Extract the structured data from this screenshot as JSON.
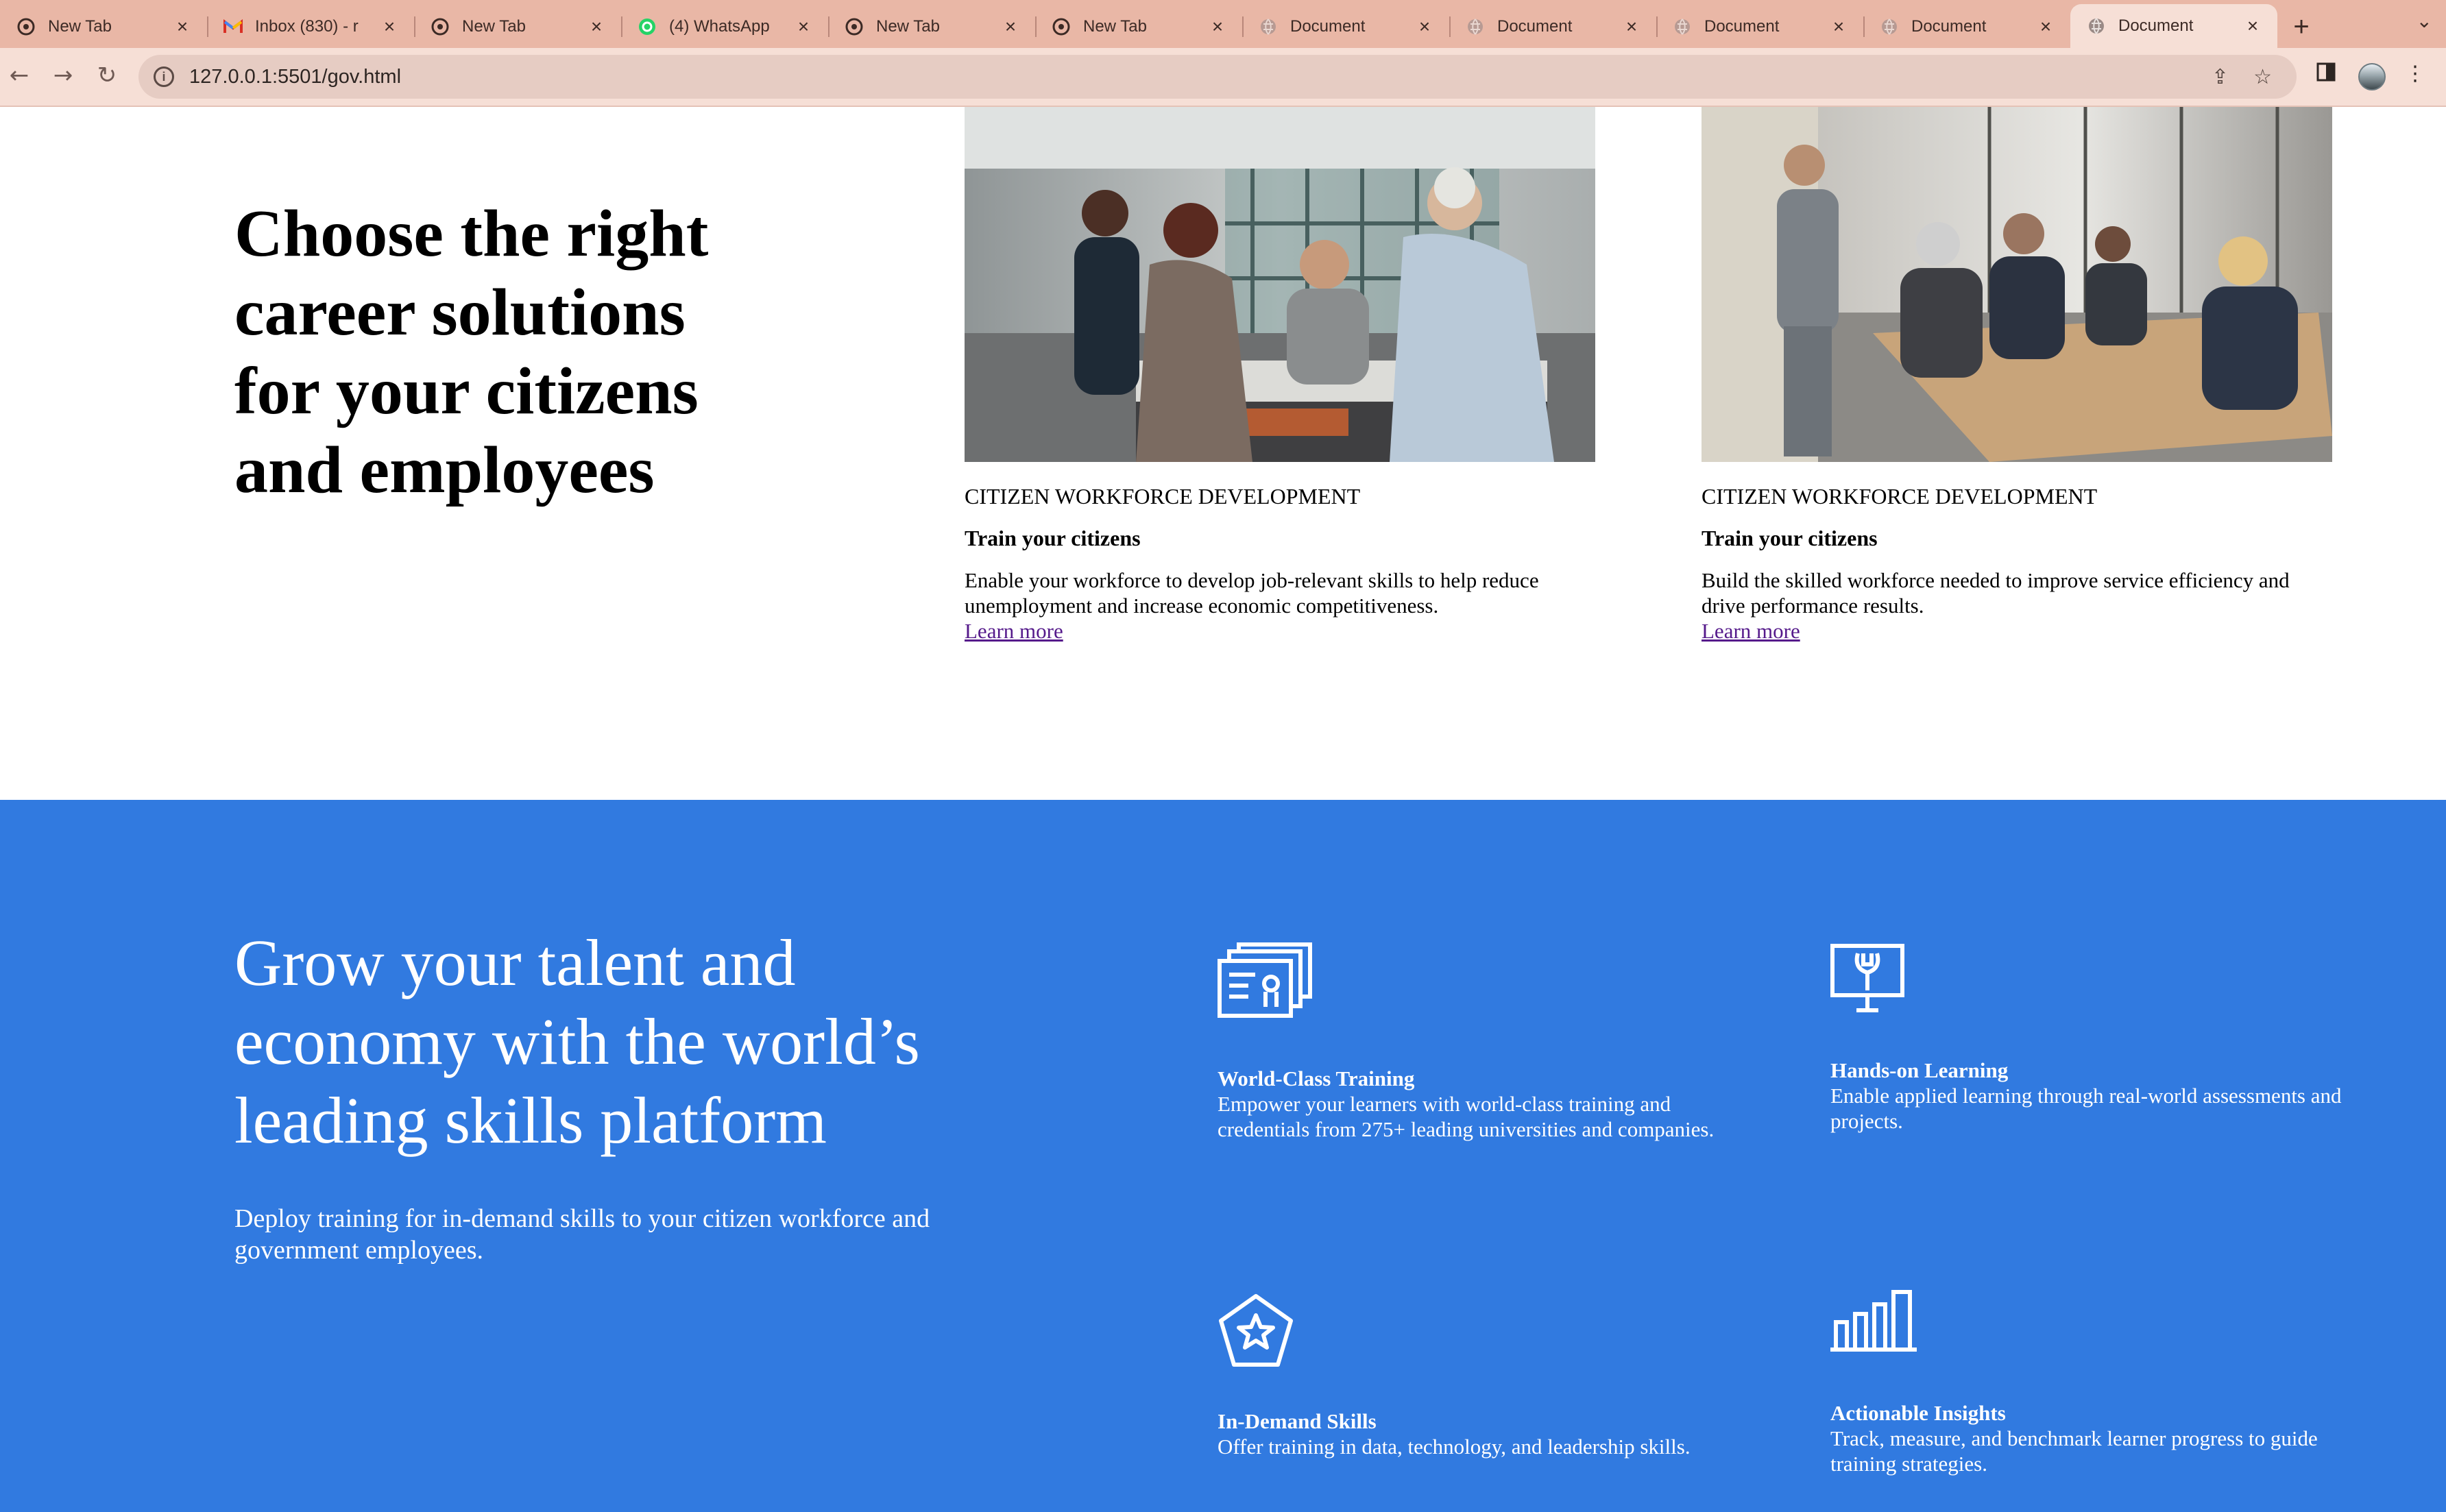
{
  "browser": {
    "tabs": [
      {
        "title": "New Tab",
        "icon": "chrome-icon"
      },
      {
        "title": "Inbox (830) - r",
        "icon": "gmail-icon"
      },
      {
        "title": "New Tab",
        "icon": "chrome-icon"
      },
      {
        "title": "(4) WhatsApp",
        "icon": "whatsapp-icon"
      },
      {
        "title": "New Tab",
        "icon": "chrome-icon"
      },
      {
        "title": "New Tab",
        "icon": "chrome-icon"
      },
      {
        "title": "Document",
        "icon": "globe-icon"
      },
      {
        "title": "Document",
        "icon": "globe-icon"
      },
      {
        "title": "Document",
        "icon": "globe-icon"
      },
      {
        "title": "Document",
        "icon": "globe-icon"
      },
      {
        "title": "Document",
        "icon": "globe-icon",
        "active": true
      }
    ],
    "new_tab_label": "+",
    "url": "127.0.0.1:5501/gov.html",
    "colors": {
      "tab_strip": "#e9b7a6",
      "toolbar": "#f6dfd6",
      "omnibox": "#e6ccc3"
    }
  },
  "hero": {
    "title": "Choose the right career solutions for your citizens and employees"
  },
  "cards": [
    {
      "category": "CITIZEN WORKFORCE DEVELOPMENT",
      "heading": "Train your citizens",
      "description": "Enable your workforce to develop job-relevant skills to help reduce unemployment and increase economic competitiveness.",
      "link": "Learn more",
      "image": "office-team-collaborating-photo"
    },
    {
      "category": "CITIZEN WORKFORCE DEVELOPMENT",
      "heading": "Train your citizens",
      "description": "Build the skilled workforce needed to improve service efficiency and drive performance results.",
      "link": "Learn more",
      "image": "business-meeting-presentation-photo"
    }
  ],
  "platform": {
    "title": "Grow your talent and economy with the world’s leading skills platform",
    "subtitle": "Deploy training for in-demand skills to your citizen workforce and government employees.",
    "background": "#317ae0",
    "features": [
      {
        "title": "World-Class Training",
        "description": "Empower your learners with world-class training and credentials from 275+ leading universities and companies.",
        "icon": "certificate-stack-icon"
      },
      {
        "title": "Hands-on Learning",
        "description": "Enable applied learning through real-world assessments and projects.",
        "icon": "monitor-wrench-icon"
      },
      {
        "title": "In-Demand Skills",
        "description": "Offer training in data, technology, and leadership skills.",
        "icon": "pentagon-star-icon"
      },
      {
        "title": "Actionable Insights",
        "description": "Track, measure, and benchmark learner progress to guide training strategies.",
        "icon": "bar-chart-icon"
      }
    ]
  }
}
